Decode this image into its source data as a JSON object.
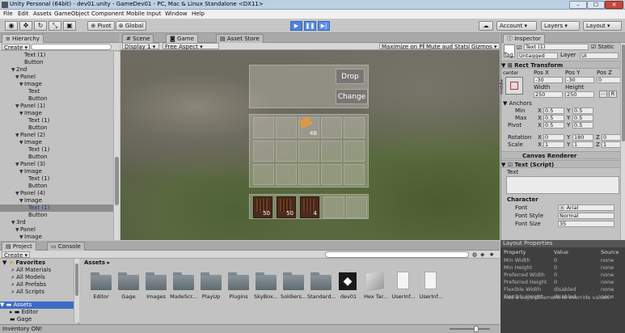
{
  "window": {
    "title": "Unity Personal (64bit) - dev01.unity - GameDev01 - PC, Mac & Linux Standalone <DX11>",
    "min": "–",
    "max": "☐",
    "close": "✕"
  },
  "menu": [
    "File",
    "Edit",
    "Assets",
    "GameObject",
    "Component",
    "Mobile Input",
    "Window",
    "Help"
  ],
  "toolbar": {
    "pivot": "Pivot",
    "global": "Global",
    "account": "Account",
    "layers": "Layers",
    "layout": "Layout",
    "play": "▶",
    "pause": "❚❚",
    "step": "▶|"
  },
  "hierarchy": {
    "tab": "Hierarchy",
    "create": "Create",
    "rows": [
      {
        "label": "Text (1)",
        "indent": 4,
        "arrow": ""
      },
      {
        "label": "Button",
        "indent": 4,
        "arrow": ""
      },
      {
        "label": "2nd",
        "indent": 2,
        "arrow": "▼"
      },
      {
        "label": "Panel",
        "indent": 3,
        "arrow": "▼"
      },
      {
        "label": "Image",
        "indent": 4,
        "arrow": "▼"
      },
      {
        "label": "Text",
        "indent": 5,
        "arrow": ""
      },
      {
        "label": "Button",
        "indent": 5,
        "arrow": ""
      },
      {
        "label": "Panel (1)",
        "indent": 3,
        "arrow": "▼"
      },
      {
        "label": "Image",
        "indent": 4,
        "arrow": "▼"
      },
      {
        "label": "Text (1)",
        "indent": 5,
        "arrow": ""
      },
      {
        "label": "Button",
        "indent": 5,
        "arrow": ""
      },
      {
        "label": "Panel (2)",
        "indent": 3,
        "arrow": "▼"
      },
      {
        "label": "Image",
        "indent": 4,
        "arrow": "▼"
      },
      {
        "label": "Text (1)",
        "indent": 5,
        "arrow": ""
      },
      {
        "label": "Button",
        "indent": 5,
        "arrow": ""
      },
      {
        "label": "Panel (3)",
        "indent": 3,
        "arrow": "▼"
      },
      {
        "label": "Image",
        "indent": 4,
        "arrow": "▼"
      },
      {
        "label": "Text (1)",
        "indent": 5,
        "arrow": ""
      },
      {
        "label": "Button",
        "indent": 5,
        "arrow": ""
      },
      {
        "label": "Panel (4)",
        "indent": 3,
        "arrow": "▼"
      },
      {
        "label": "Image",
        "indent": 4,
        "arrow": "▼"
      },
      {
        "label": "Text (1)",
        "indent": 5,
        "arrow": "",
        "selected": true
      },
      {
        "label": "Button",
        "indent": 5,
        "arrow": ""
      },
      {
        "label": "3rd",
        "indent": 2,
        "arrow": "▼"
      },
      {
        "label": "Panel",
        "indent": 3,
        "arrow": "▼"
      },
      {
        "label": "Image",
        "indent": 4,
        "arrow": "▼"
      }
    ]
  },
  "center_tabs": {
    "scene": "Scene",
    "game": "Game",
    "asset_store": "Asset Store"
  },
  "game_bar": {
    "display": "Display 1",
    "aspect": "Free Aspect",
    "maximize": "Maximize on Play",
    "mute": "Mute audio",
    "stats": "Stats",
    "gizmos": "Gizmos"
  },
  "game": {
    "drop": "Drop",
    "change": "Change",
    "slot_count": "48",
    "items": [
      "50",
      "50",
      "4"
    ]
  },
  "inspector": {
    "tab": "Inspector",
    "name": "Text (1)",
    "static": "Static",
    "tag_label": "Tag",
    "tag": "Untagged",
    "layer_label": "Layer",
    "layer": "UI",
    "rect_transform": "Rect Transform",
    "center": "center",
    "middle": "middle",
    "pos_x_label": "Pos X",
    "pos_y_label": "Pos Y",
    "pos_z_label": "Pos Z",
    "pos_x": "-30",
    "pos_y": "-30",
    "pos_z": "0",
    "width_label": "Width",
    "height_label": "Height",
    "width": "250",
    "height": "250",
    "r_btn": "R",
    "anchors": "Anchors",
    "min_label": "Min",
    "max_label": "Max",
    "pivot_label": "Pivot",
    "x": "X",
    "y": "Y",
    "z": "Z",
    "min_x": "0.5",
    "min_y": "0.5",
    "max_x": "0.5",
    "max_y": "0.5",
    "pivot_x": "0.5",
    "pivot_y": "0.5",
    "rotation_label": "Rotation",
    "rot_x": "0",
    "rot_y": "180",
    "rot_z": "0",
    "scale_label": "Scale",
    "scale_x": "1",
    "scale_y": "1",
    "scale_z": "1",
    "canvas_renderer": "Canvas Renderer",
    "text_script": "Text (Script)",
    "text_label": "Text",
    "character": "Character",
    "font_label": "Font",
    "font": "Arial",
    "font_style_label": "Font Style",
    "font_style": "Normal",
    "font_size_label": "Font Size",
    "font_size": "35"
  },
  "layout_properties": {
    "title": "Layout Properties",
    "headers": [
      "Property",
      "Value",
      "Source"
    ],
    "rows": [
      [
        "Min Width",
        "0",
        "none"
      ],
      [
        "Min Height",
        "0",
        "none"
      ],
      [
        "Preferred Width",
        "0",
        "none"
      ],
      [
        "Preferred Height",
        "0",
        "none"
      ],
      [
        "Flexible Width",
        "disabled",
        "none"
      ],
      [
        "Flexible Height",
        "disabled",
        "none"
      ]
    ],
    "note": "Add a LayoutElement to override values."
  },
  "project": {
    "tab": "Project",
    "console": "Console",
    "create": "Create",
    "favorites": "Favorites",
    "fav_items": [
      "All Materials",
      "All Models",
      "All Prefabs",
      "All Scripts"
    ],
    "assets_root": "Assets",
    "asset_tree": [
      "Editor",
      "Gage"
    ],
    "breadcrumb": "Assets",
    "items": [
      "Editor",
      "Gage",
      "Images",
      "MadeScr...",
      "PlayUp",
      "Plugins",
      "SkyBox...",
      "Soldiers...",
      "Standard...",
      "dev01",
      "Hex Tar...",
      "UserInf...",
      "UserInf..."
    ]
  },
  "status": "Inventory ON!"
}
